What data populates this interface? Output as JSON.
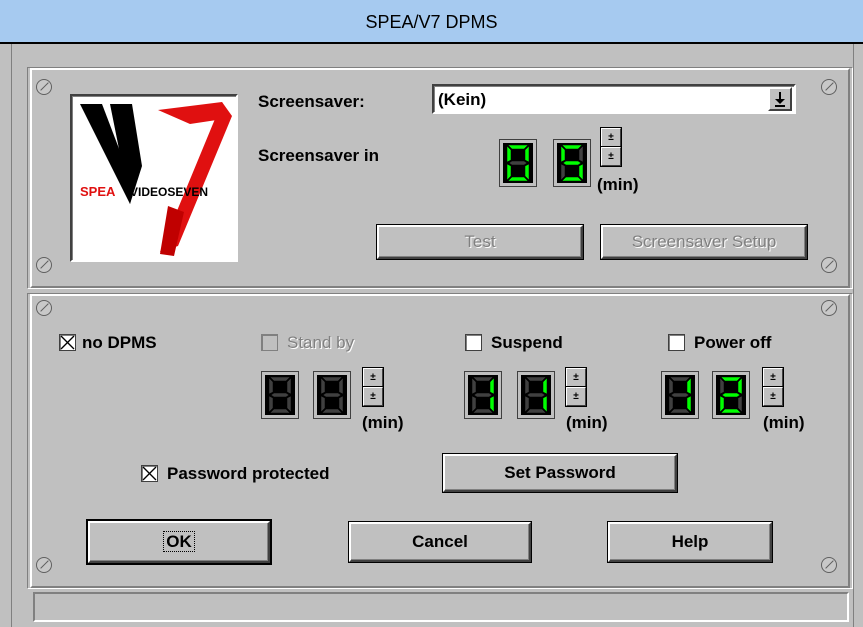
{
  "window": {
    "title": "SPEA/V7 DPMS"
  },
  "logo": {
    "brand_left": "SPEA",
    "brand_right": "VIDEOSEVEN",
    "accent": "#e01010",
    "dark": "#000000"
  },
  "screensaver": {
    "label": "Screensaver:",
    "selected": "(Kein)",
    "delay_label": "Screensaver in",
    "delay_digits": [
      "0",
      "5"
    ],
    "unit": "(min)",
    "test_label": "Test",
    "setup_label": "Screensaver Setup"
  },
  "dpms": {
    "no_dpms": {
      "label": "no DPMS",
      "checked": true
    },
    "standby": {
      "label": "Stand by",
      "checked": false,
      "enabled": false,
      "digits": [
        "8",
        "8"
      ],
      "unit": "(min)"
    },
    "suspend": {
      "label": "Suspend",
      "checked": false,
      "enabled": true,
      "digits": [
        "1",
        "1"
      ],
      "unit": "(min)"
    },
    "poweroff": {
      "label": "Power off",
      "checked": false,
      "enabled": true,
      "digits": [
        "1",
        "2"
      ],
      "unit": "(min)"
    }
  },
  "password": {
    "label": "Password protected",
    "checked": true,
    "set_label": "Set Password"
  },
  "buttons": {
    "ok": "OK",
    "cancel": "Cancel",
    "help": "Help"
  },
  "colors": {
    "digit_on": "#00ff00",
    "digit_off": "#404040",
    "titlebar": "#a6caf0"
  }
}
